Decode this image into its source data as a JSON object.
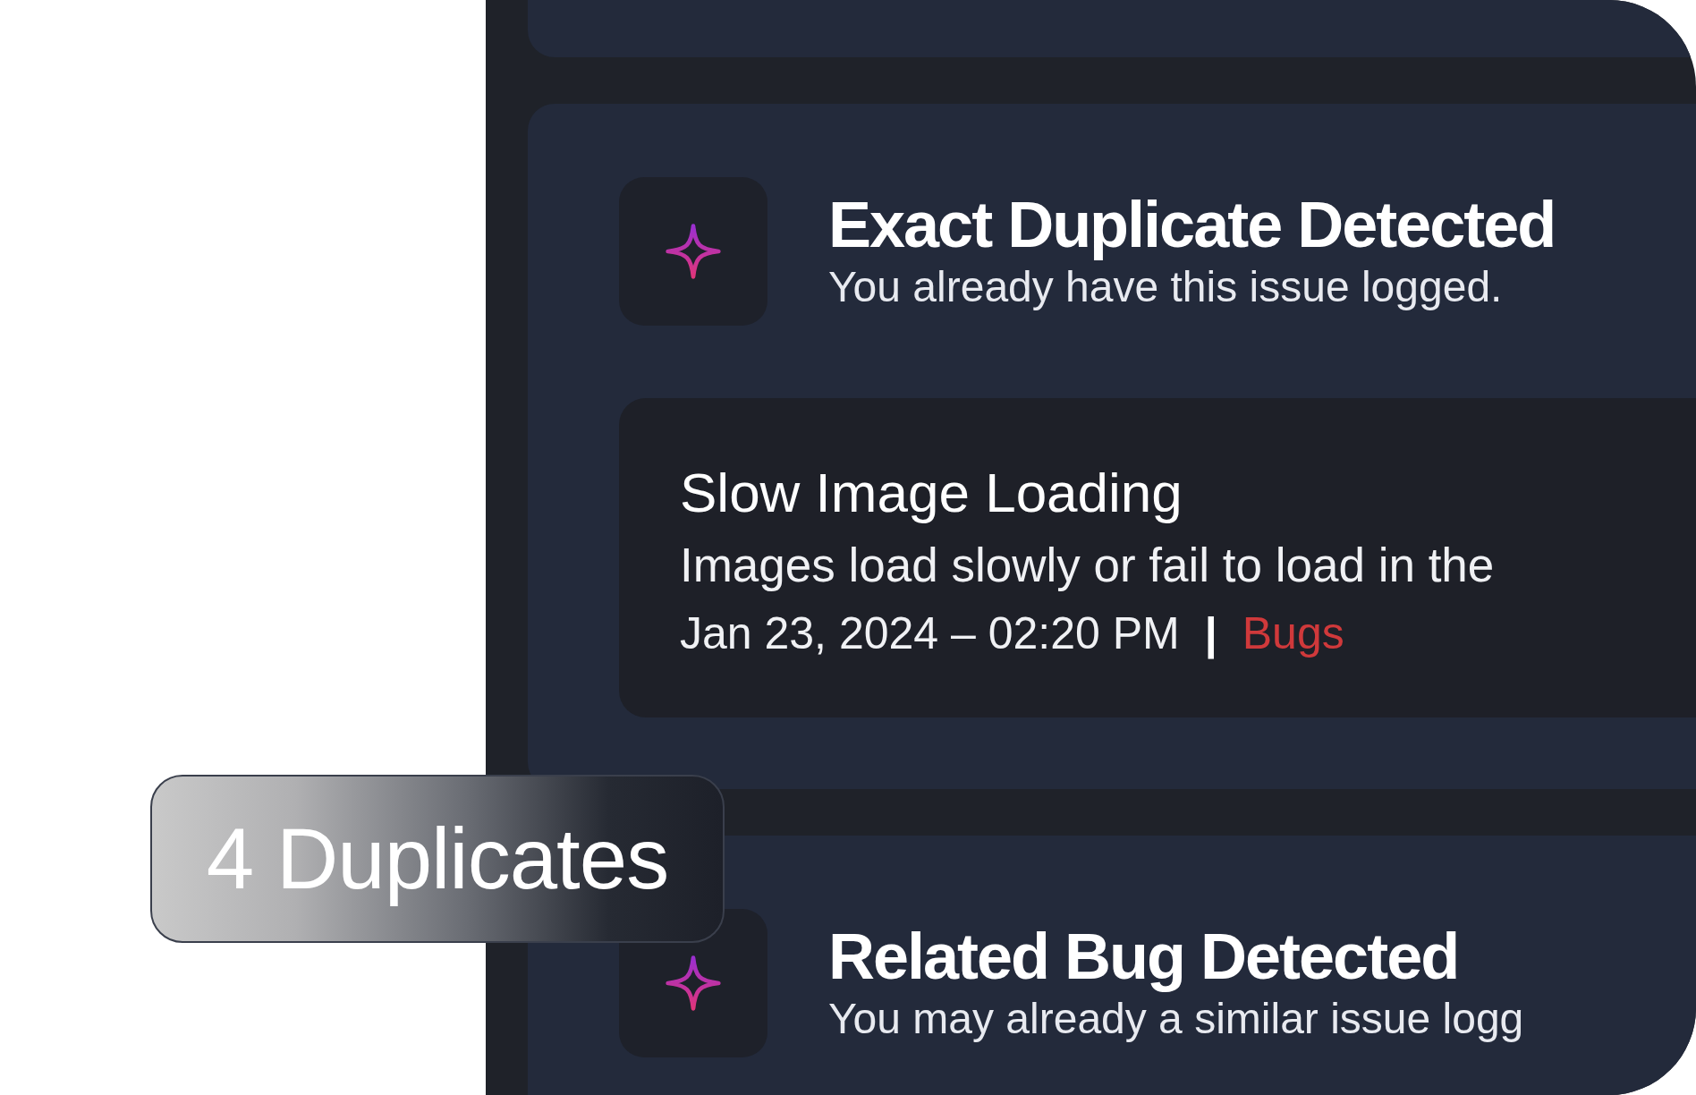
{
  "suggestions": [
    {
      "title": "Exact Duplicate Detected",
      "subtitle": "You already have this issue logged.",
      "issue": {
        "title": "Slow Image Loading",
        "description": "Images load slowly or fail to load in the",
        "date": "Jan 23, 2024 – 02:20 PM",
        "separator": "|",
        "category": "Bugs"
      }
    },
    {
      "title": "Related Bug Detected",
      "subtitle": "You may already a similar issue logg"
    }
  ],
  "badge": {
    "label": "4 Duplicates"
  }
}
